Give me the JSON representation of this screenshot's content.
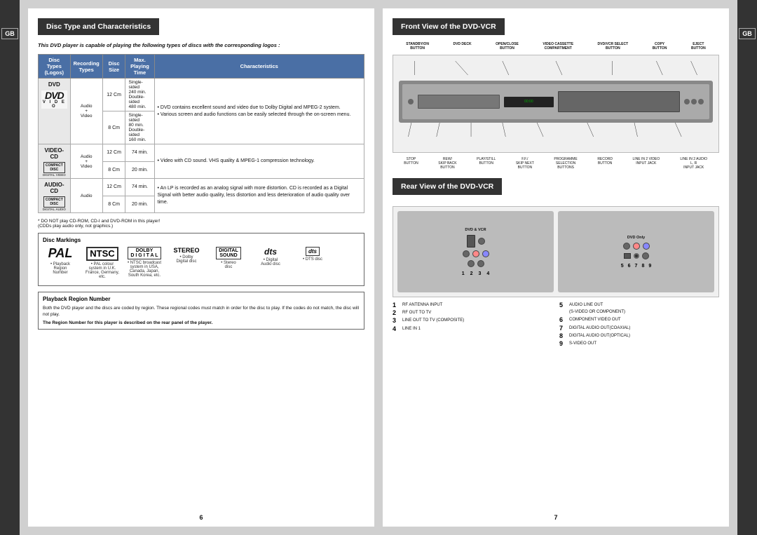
{
  "left_tab": {
    "label": "GB"
  },
  "right_tab": {
    "label": "GB"
  },
  "left_page": {
    "section_title": "Disc Type and Characteristics",
    "intro_text": "This DVD player is capable of playing the following types of discs with the corresponding logos :",
    "table": {
      "headers": [
        "Disc Types\n(Logos)",
        "Recording\nTypes",
        "Disc Size",
        "Max.\nPlaying\nTime",
        "Characteristics"
      ],
      "rows": [
        {
          "disc_type": "DVD",
          "logo_type": "dvd",
          "recording": "Audio\n+\nVideo",
          "sizes": [
            {
              "size": "12 Cm",
              "time": "Single-sided\n240 min.\nDouble-sided\n480 min."
            },
            {
              "size": "8 Cm",
              "time": "Single-sided\n80 min.\nDouble-sided\n160 min."
            }
          ],
          "characteristics": "• DVD contains excellent sound and video due to Dolby Digital and MPEG-2 system.\n• Various screen and audio functions can be easily selected through the on-screen menu."
        },
        {
          "disc_type": "VIDEO-CD",
          "logo_type": "video-cd",
          "recording": "Audio\n+\nVideo",
          "sizes": [
            {
              "size": "12 Cm",
              "time": "74 min."
            },
            {
              "size": "8 Cm",
              "time": "20 min."
            }
          ],
          "characteristics": "• Video with CD sound. VHS quality & MPEG-1 compression technology."
        },
        {
          "disc_type": "AUDIO-CD",
          "logo_type": "audio-cd",
          "recording": "Audio",
          "sizes": [
            {
              "size": "12 Cm",
              "time": "74 min."
            },
            {
              "size": "8 Cm",
              "time": "20 min."
            }
          ],
          "characteristics": "• An LP is recorded as an analog signal with more distortion. CD is recorded as a Digital Signal with better audio quality, less distortion and less deterioration of audio quality over time."
        }
      ]
    },
    "footnote": "* DO NOT play CD-ROM, CD-I and DVD-ROM in this player!\n(CDDs play audio only, not graphics.)",
    "disc_markings": {
      "title": "Disc Markings",
      "items": [
        {
          "logo": "PAL",
          "type": "pal",
          "desc": "• Playback\nRegion\nNumber"
        },
        {
          "logo": "NTSC",
          "type": "ntsc",
          "desc": "• PAL colour\nsystem in U.K.\nFrance, Germany,\netc."
        },
        {
          "logo": "DOLBY\nDIGITAL",
          "type": "dolby",
          "desc": "• NTSC broadcast\nsystem in USA,\nCanada, Japan,\nSouth Korea, etc."
        },
        {
          "logo": "STEREO",
          "type": "stereo",
          "desc": "• Dolby\nDigital disc"
        },
        {
          "logo": "DIGITAL\nSOUND",
          "type": "digital-sound",
          "desc": "• Stereo\ndisc"
        },
        {
          "logo": "dts",
          "type": "dts",
          "desc": "• Digital\nAudio disc"
        },
        {
          "logo": "",
          "type": "dts-disc",
          "desc": "• DTS disc"
        }
      ]
    },
    "playback_region": {
      "title": "Playback Region Number",
      "text": "Both the DVD player and the discs are coded by region. These regional codes must match in order for the disc to play. If the codes do not match, the disc will not play.",
      "bold_text": "The Region Number for this player is described on the rear panel of the player."
    },
    "page_number": "6"
  },
  "right_page": {
    "front_section": {
      "title": "Front View of the DVD-VCR",
      "top_labels": [
        "STANDBY/ON\nBUTTON",
        "DVD DECK",
        "OPEN/CLOSE\nBUTTON",
        "VIDEO CASSETTE\nCOMPARTMENT",
        "DVD/VCR SELECT\nBUTTON",
        "COPY\nBUTTON",
        "EJECT\nBUTTON"
      ],
      "bottom_labels": [
        "STOP\nBUTTON",
        "REW/\nSKIP BACK\nBUTTON",
        "PLAY/STILL\nBUTTON",
        "F.F./\nSKIP NEXT\nBUTTON",
        "PROGRAMME\nSELECTION\nBUTTONS",
        "RECORD\nBUTTON",
        "LINE IN 2 VIDEO\nINPUT JACK",
        "LINE IN 2 AUDIO L, R\nINPUT JACK"
      ]
    },
    "rear_section": {
      "title": "Rear View of the DVD-VCR",
      "panels": [
        {
          "title": "DVD & VCR",
          "subtitle": ""
        },
        {
          "title": "DVD Only",
          "subtitle": ""
        }
      ],
      "numbers": [
        "1",
        "2",
        "3",
        "4",
        "5",
        "6",
        "7",
        "8",
        "9"
      ],
      "legend": [
        {
          "num": "1",
          "label": "RF ANTENNA INPUT"
        },
        {
          "num": "2",
          "label": "RF OUT TO TV"
        },
        {
          "num": "3",
          "label": "LINE OUT TO TV (COMPOSITE)"
        },
        {
          "num": "4",
          "label": "LINE IN 1"
        },
        {
          "num": "5",
          "label": "AUDIO LINE OUT\n(S-VIDEO OR COMPONENT)"
        },
        {
          "num": "6",
          "label": "COMPONENT VIDEO OUT"
        },
        {
          "num": "7",
          "label": "DIGITAL AUDIO OUT(COAXIAL)"
        },
        {
          "num": "8",
          "label": "DIGITAL AUDIO OUT(OPTICAL)"
        },
        {
          "num": "9",
          "label": "S-VIDEO OUT"
        }
      ]
    },
    "page_number": "7"
  },
  "colors": {
    "header_bg": "#2a2a2a",
    "table_header_bg": "#4a6fa5",
    "section_border": "#555555",
    "page_bg": "#d0d0d0"
  }
}
